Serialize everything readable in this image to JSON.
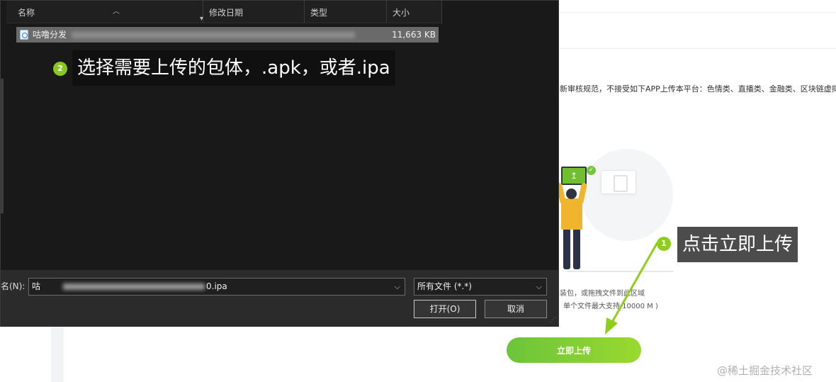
{
  "background_page": {
    "notice_text": "新审核规范，不接受如下APP上传本平台：色情类、直播类、金融类、区块链虚拟币",
    "upload_hint_line1": "装包，或拖拽文件到此区域",
    "upload_hint_line2": "单个文件最大支持 10000 M )",
    "upload_button_label": "立即上传",
    "upload_icon": "upload-arrow-icon",
    "check_icon": "✓"
  },
  "watermark": "@稀土掘金技术社区",
  "annotations": {
    "step1_number": "1",
    "step1_text": "点击立即上传",
    "step2_number": "2",
    "step2_text": "选择需要上传的包体，.apk，或者.ipa",
    "accent_color": "#8fcf1b"
  },
  "file_dialog": {
    "columns": [
      "名称",
      "修改日期",
      "类型",
      "大小"
    ],
    "files": [
      {
        "name": "咕噜分发",
        "size": "11,663 KB"
      }
    ],
    "filename_label": "名(N):",
    "filename_value_prefix": "咕",
    "filename_value_suffix": "0.ipa",
    "filetype_value": "所有文件 (*.*)",
    "open_button": "打开(O)",
    "cancel_button": "取消"
  }
}
